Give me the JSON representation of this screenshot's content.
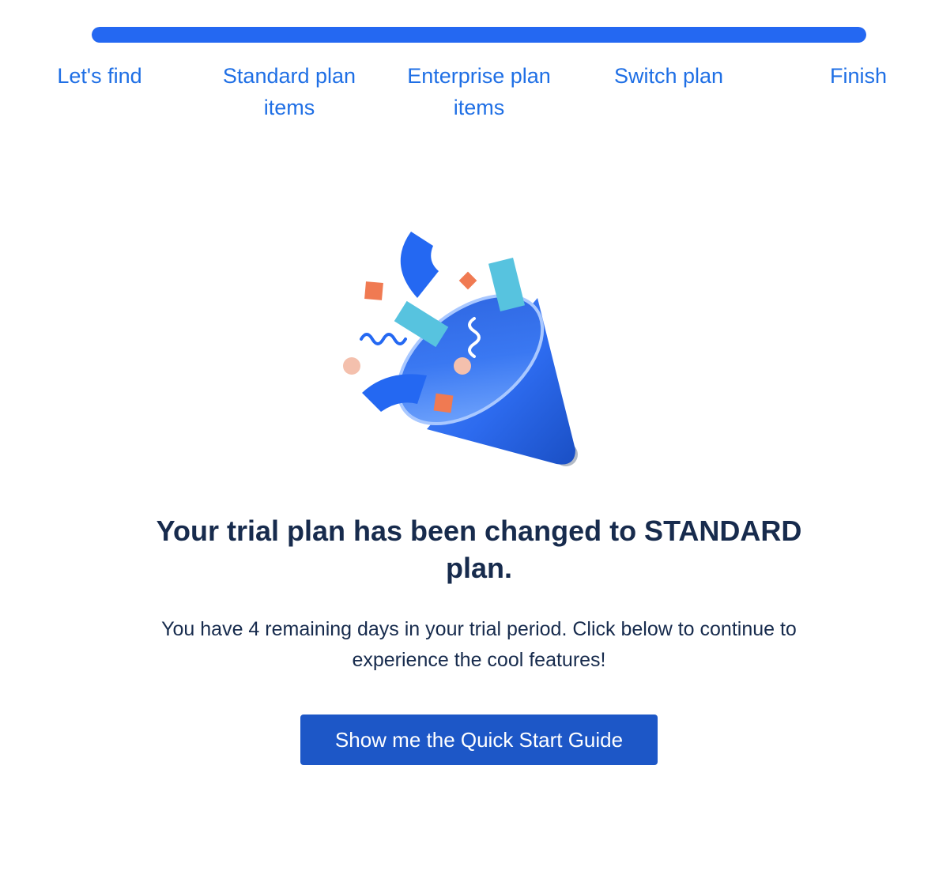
{
  "progress": {
    "value": 1.0
  },
  "steps": [
    {
      "label": "Let's find"
    },
    {
      "label": "Standard plan items"
    },
    {
      "label": "Enterprise plan items"
    },
    {
      "label": "Switch plan"
    },
    {
      "label": "Finish"
    }
  ],
  "illustration": {
    "icon": "party-popper-icon"
  },
  "content": {
    "headline": "Your trial plan has been changed to STANDARD plan.",
    "body": "You have 4 remaining days in your trial period. Click below to continue to experience the cool features!"
  },
  "cta": {
    "label": "Show me the Quick Start Guide"
  },
  "colors": {
    "accent": "#2468f2",
    "link": "#1f6fe5",
    "button": "#1d57c7",
    "text": "#172b4d"
  }
}
